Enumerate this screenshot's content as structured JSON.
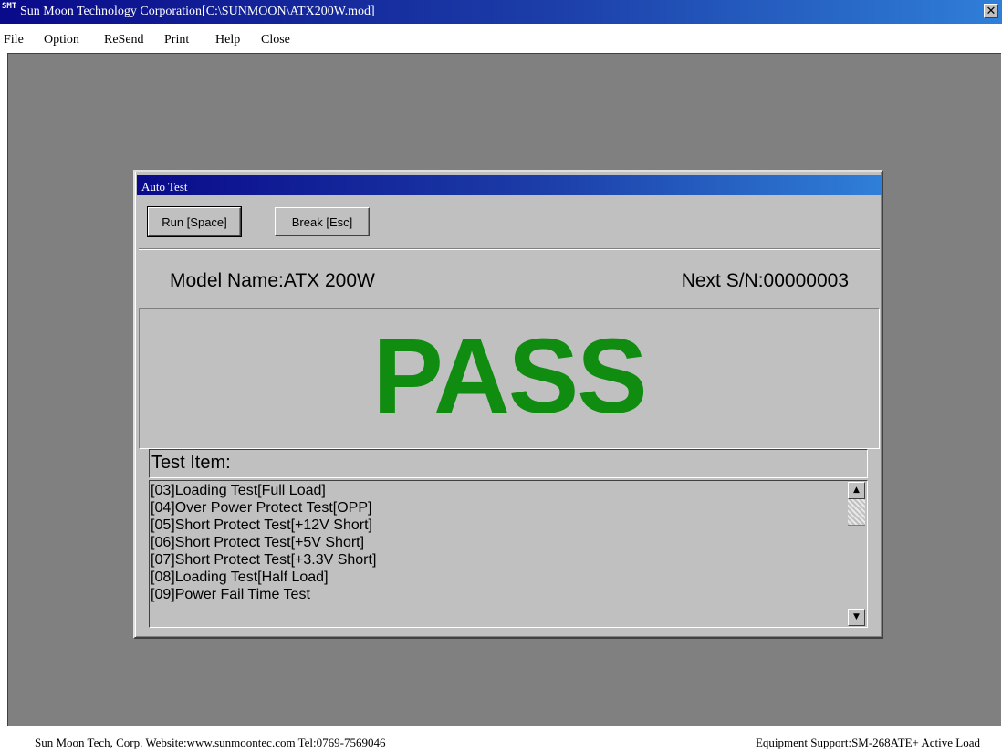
{
  "window": {
    "icon_text": "SMT",
    "title": "Sun Moon Technology Corporation[C:\\SUNMOON\\ATX200W.mod]",
    "close_glyph": "✕"
  },
  "menu": [
    {
      "label": "File"
    },
    {
      "label": "Option"
    },
    {
      "label": "ReSend"
    },
    {
      "label": "Print"
    },
    {
      "label": "Help"
    },
    {
      "label": "Close"
    }
  ],
  "dialog": {
    "title": "Auto Test",
    "run_label": "Run [Space]",
    "break_label": "Break [Esc]",
    "model_name": "Model Name:ATX 200W",
    "next_sn": "Next S/N:00000003",
    "result": "PASS",
    "result_color": "#108c10",
    "test_item_header": "Test Item:",
    "test_items": [
      "[03]Loading Test[Full Load]",
      "[04]Over Power Protect Test[OPP]",
      "[05]Short Protect Test[+12V Short]",
      "[06]Short Protect Test[+5V Short]",
      "[07]Short Protect Test[+3.3V Short]",
      "[08]Loading Test[Half Load]",
      "[09]Power Fail Time Test"
    ],
    "scroll_up_glyph": "▲",
    "scroll_down_glyph": "▼"
  },
  "status": {
    "left": "Sun Moon Tech, Corp. Website:www.sunmoontec.com Tel:0769-7569046",
    "right": "Equipment Support:SM-268ATE+ Active Load"
  }
}
